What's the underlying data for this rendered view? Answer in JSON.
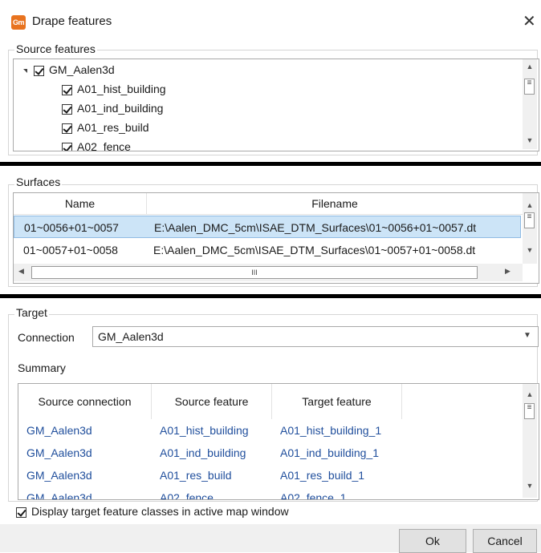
{
  "window": {
    "title": "Drape features",
    "app_icon_text": "Gm",
    "close_glyph": "✕"
  },
  "source": {
    "label": "Source features",
    "root": "GM_Aalen3d",
    "items": [
      {
        "label": "A01_hist_building",
        "checked": true
      },
      {
        "label": "A01_ind_building",
        "checked": true
      },
      {
        "label": "A01_res_build",
        "checked": true
      },
      {
        "label": "A02_fence",
        "checked": true
      }
    ]
  },
  "surfaces": {
    "label": "Surfaces",
    "columns": [
      "Name",
      "Filename"
    ],
    "rows": [
      {
        "name": "01~0056+01~0057",
        "filename": "E:\\Aalen_DMC_5cm\\ISAE_DTM_Surfaces\\01~0056+01~0057.dt",
        "selected": true
      },
      {
        "name": "01~0057+01~0058",
        "filename": "E:\\Aalen_DMC_5cm\\ISAE_DTM_Surfaces\\01~0057+01~0058.dt",
        "selected": false
      }
    ],
    "hscroll_thumb_glyph": "III"
  },
  "target": {
    "label": "Target",
    "connection_label": "Connection",
    "connection_value": "GM_Aalen3d",
    "summary_label": "Summary",
    "columns": [
      "Source connection",
      "Source feature",
      "Target feature"
    ],
    "rows": [
      {
        "source_connection": "GM_Aalen3d",
        "source_feature": "A01_hist_building",
        "target_feature": "A01_hist_building_1"
      },
      {
        "source_connection": "GM_Aalen3d",
        "source_feature": "A01_ind_building",
        "target_feature": "A01_ind_building_1"
      },
      {
        "source_connection": "GM_Aalen3d",
        "source_feature": "A01_res_build",
        "target_feature": "A01_res_build_1"
      },
      {
        "source_connection": "GM_Aalen3d",
        "source_feature": "A02_fence",
        "target_feature": "A02_fence_1"
      }
    ]
  },
  "display_option": {
    "label": "Display target feature classes in active map window",
    "checked": true
  },
  "buttons": {
    "ok": "Ok",
    "cancel": "Cancel"
  },
  "colors": {
    "selection": "#cce4f7",
    "link": "#1f4e9c",
    "app_icon": "#e8731f"
  }
}
